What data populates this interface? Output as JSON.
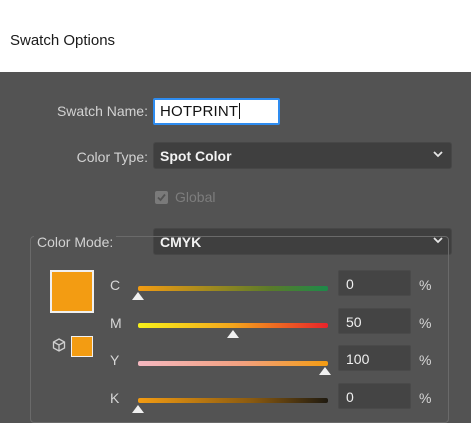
{
  "dialog": {
    "title": "Swatch Options"
  },
  "form": {
    "swatch_name_label": "Swatch Name:",
    "swatch_name_value": "HOTPRINT",
    "color_type_label": "Color Type:",
    "color_type_value": "Spot Color",
    "global_label": "Global",
    "global_checked": true,
    "global_enabled": false,
    "color_mode_label": "Color Mode:",
    "color_mode_value": "CMYK"
  },
  "color": {
    "swatch_color": "#f39c12",
    "channels": [
      {
        "letter": "C",
        "value": "0",
        "unit": "%"
      },
      {
        "letter": "M",
        "value": "50",
        "unit": "%"
      },
      {
        "letter": "Y",
        "value": "100",
        "unit": "%"
      },
      {
        "letter": "K",
        "value": "0",
        "unit": "%"
      }
    ]
  },
  "icons": {
    "dropdown": "chevron-down-icon",
    "out_of_gamut": "cube-icon",
    "checkbox": "checkmark-icon"
  }
}
